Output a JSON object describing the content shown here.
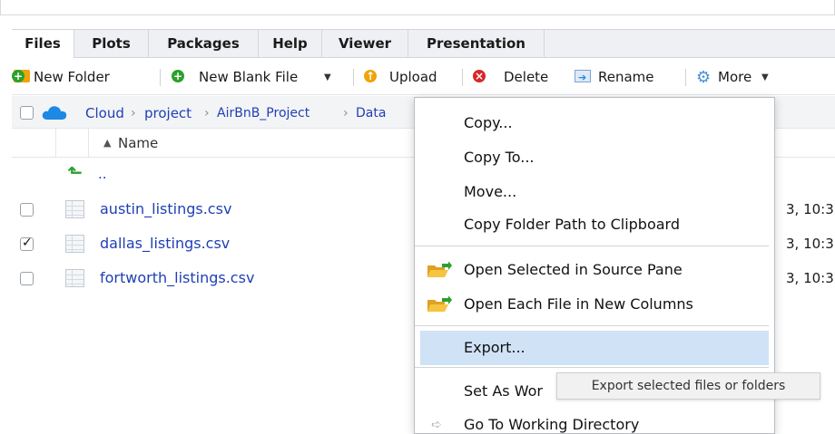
{
  "tabs": [
    {
      "label": "Files",
      "active": true
    },
    {
      "label": "Plots"
    },
    {
      "label": "Packages"
    },
    {
      "label": "Help"
    },
    {
      "label": "Viewer"
    },
    {
      "label": "Presentation"
    }
  ],
  "toolbar": {
    "new_folder": "New Folder",
    "new_blank_file": "New Blank File",
    "upload": "Upload",
    "delete": "Delete",
    "rename": "Rename",
    "more": "More"
  },
  "breadcrumb": [
    "Cloud",
    "project",
    "AirBnB_Project",
    "Data"
  ],
  "column_header": {
    "name": "Name",
    "sort_glyph": "▲"
  },
  "parent_dir": "..",
  "files": [
    {
      "name": "austin_listings.csv",
      "checked": false,
      "modified": "3, 10:3"
    },
    {
      "name": "dallas_listings.csv",
      "checked": true,
      "modified": "3, 10:3"
    },
    {
      "name": "fortworth_listings.csv",
      "checked": false,
      "modified": "3, 10:3"
    }
  ],
  "menu": {
    "copy": "Copy...",
    "copy_to": "Copy To...",
    "move": "Move...",
    "copy_path": "Copy Folder Path to Clipboard",
    "open_source": "Open Selected in Source Pane",
    "open_columns": "Open Each File in New Columns",
    "export": "Export...",
    "set_wd": "Set As Wor",
    "goto_wd": "Go To Working Directory"
  },
  "tooltip": "Export selected files or folders",
  "colors": {
    "link_blue": "#1f3fb5",
    "highlight": "#cfe2f6",
    "green": "#2ca02c",
    "red": "#d62728",
    "orange": "#f0a30a",
    "cloud": "#1e88e5"
  }
}
